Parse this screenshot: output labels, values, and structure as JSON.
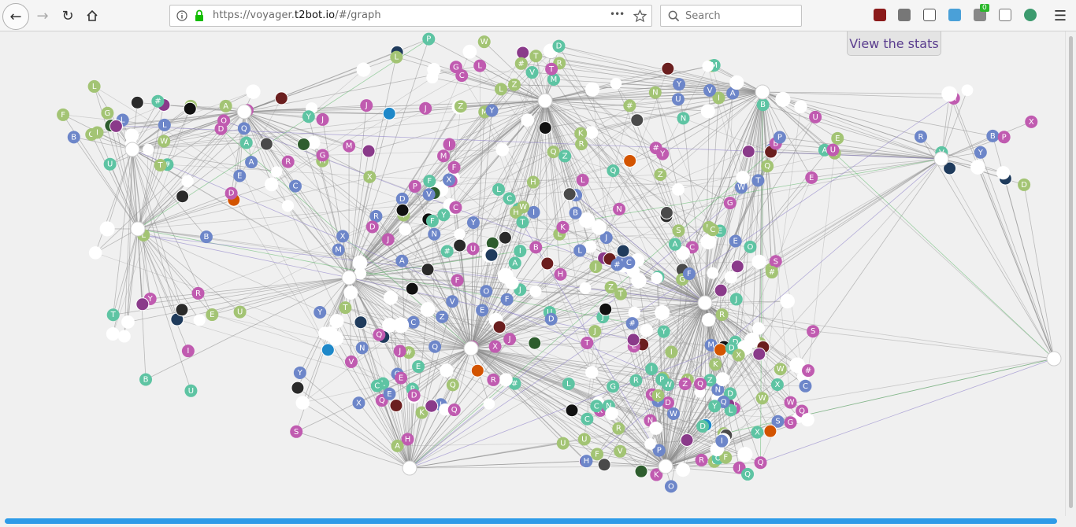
{
  "browser": {
    "url_prefix": "https://voyager.",
    "url_domain": "t2bot.io",
    "url_suffix": "/#/graph",
    "search_placeholder": "Search",
    "menu_dots": "•••",
    "ext_badge": "0"
  },
  "page": {
    "stats_button": "View the stats"
  },
  "graph": {
    "colors": {
      "edge": "#8c8c8c",
      "edge_purple": "#8a7dc8",
      "edge_green": "#5fb86a",
      "blue": "#6d86c9",
      "green": "#a3c474",
      "pink": "#c05bb0",
      "teal": "#5ec4a3",
      "white": "#ffffff"
    },
    "letters": [
      "#",
      "R",
      "L",
      "M",
      "S",
      "C",
      "D",
      "W",
      "P",
      "Q",
      "A",
      "I",
      "E",
      "O",
      "V",
      "Y",
      "F",
      "H",
      "T",
      "K",
      "N",
      "G",
      "B",
      "U",
      "Z",
      "J",
      "X"
    ]
  }
}
